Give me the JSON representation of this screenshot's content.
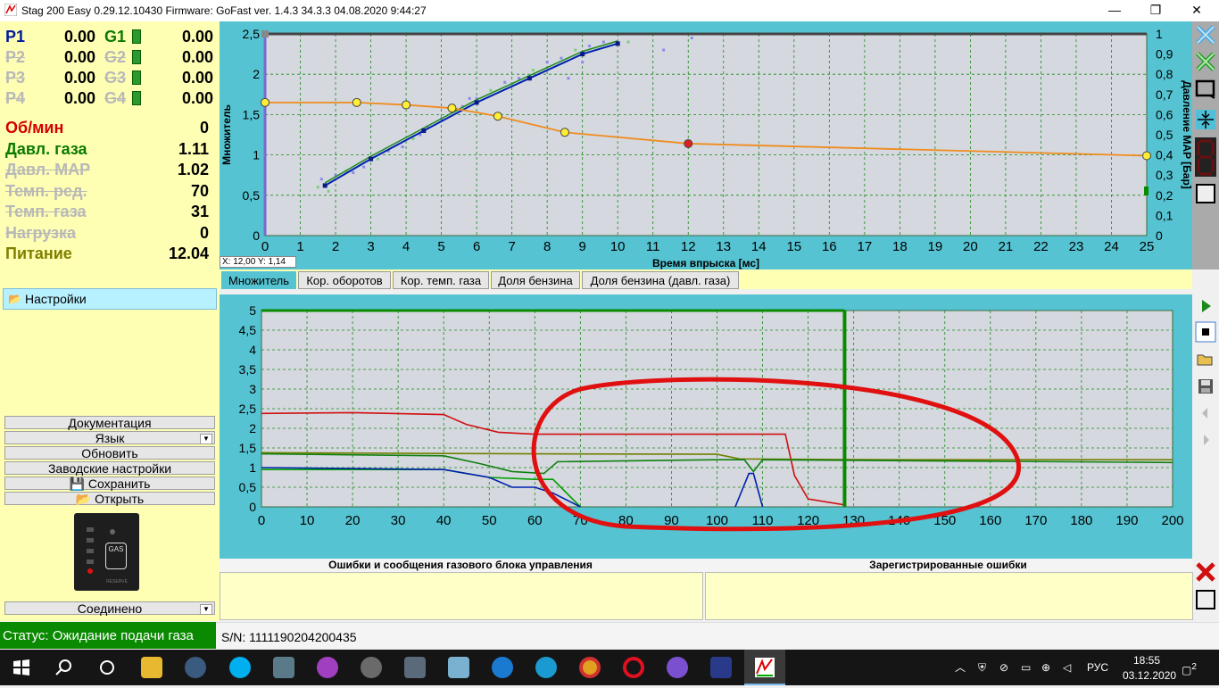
{
  "window": {
    "title": "Stag 200 Easy 0.29.12.10430 Firmware: GoFast  ver. 1.4.3  34.3.3   04.08.2020 9:44:27",
    "minimize": "—",
    "maximize": "❐",
    "close": "✕"
  },
  "injectors": [
    {
      "p": "P1",
      "p_val": "0.00",
      "g": "G1",
      "g_val": "0.00",
      "active": true
    },
    {
      "p": "P2",
      "p_val": "0.00",
      "g": "G2",
      "g_val": "0.00",
      "active": false
    },
    {
      "p": "P3",
      "p_val": "0.00",
      "g": "G3",
      "g_val": "0.00",
      "active": false
    },
    {
      "p": "P4",
      "p_val": "0.00",
      "g": "G4",
      "g_val": "0.00",
      "active": false
    }
  ],
  "params": [
    {
      "label": "Об/мин",
      "value": "0",
      "style": "red"
    },
    {
      "label": "Давл. газа",
      "value": "1.11",
      "style": "green"
    },
    {
      "label": "Давл. MAP",
      "value": "1.02",
      "style": "strike"
    },
    {
      "label": "Темп. ред.",
      "value": "70",
      "style": "strike"
    },
    {
      "label": "Темп. газа",
      "value": "31",
      "style": "strike"
    },
    {
      "label": "Нагрузка",
      "value": "0",
      "style": "strike"
    },
    {
      "label": "Питание",
      "value": "12.04",
      "style": "olive"
    }
  ],
  "settings": {
    "label": "Настройки"
  },
  "buttons": {
    "documentation": "Документация",
    "language": "Язык",
    "update": "Обновить",
    "factory": "Заводские настройки",
    "save": "Сохранить",
    "open": "Открыть",
    "connection": "Соединено"
  },
  "ecu": {
    "label": "GAS",
    "sublabel": "RESERVE"
  },
  "status": "Статус: Ожидание подачи газа",
  "serial": "S/N: 1111190204200435",
  "top_chart": {
    "ylabel": "Множитель",
    "xlabel": "Время впрыска [мс]",
    "y2label": "Давление MAP [Бар]",
    "cursor": "X: 12,00  Y: 1,14"
  },
  "tabs": [
    "Множитель",
    "Кор. оборотов",
    "Кор. темп. газа",
    "Доля бензина",
    "Доля бензина (давл. газа)"
  ],
  "errors": {
    "left_header": "Ошибки и сообщения газового блока управления",
    "right_header": "Зарегистрированные ошибки"
  },
  "taskbar": {
    "lang": "РУС",
    "time": "18:55",
    "date": "03.12.2020",
    "notif": "2"
  },
  "colors": {
    "chart_bg": "#d5d8df",
    "panel": "#55c3d2",
    "left_bg": "#ffffb4",
    "status_green": "#0a8a00",
    "multiplier": "#f08c1e",
    "fit_line": "#0020b0"
  },
  "chart_data": [
    {
      "type": "line",
      "xlim": [
        0,
        25
      ],
      "ylim": [
        0,
        2.5
      ],
      "y2lim": [
        0,
        1
      ],
      "x_ticks": [
        0,
        1,
        2,
        3,
        4,
        5,
        6,
        7,
        8,
        9,
        10,
        11,
        12,
        13,
        14,
        15,
        16,
        17,
        18,
        19,
        20,
        21,
        22,
        23,
        24,
        25
      ],
      "y_ticks": [
        "0",
        "0,5",
        "1",
        "1,5",
        "2",
        "2,5"
      ],
      "y2_ticks": [
        "0",
        "0,1",
        "0,2",
        "0,3",
        "0,4",
        "0,5",
        "0,6",
        "0,7",
        "0,8",
        "0,9",
        "1"
      ],
      "series": [
        {
          "role": "multiplier",
          "color": "#f08c1e",
          "x": [
            0,
            2.6,
            4,
            5.3,
            6.6,
            8.5,
            12,
            25
          ],
          "y": [
            1.65,
            1.65,
            1.62,
            1.58,
            1.48,
            1.28,
            1.14,
            0.99
          ]
        },
        {
          "role": "fit",
          "color": "#0020b0",
          "x": [
            1.7,
            3,
            4.5,
            6,
            7.5,
            9,
            10
          ],
          "y": [
            0.62,
            0.95,
            1.3,
            1.65,
            1.95,
            2.25,
            2.38
          ]
        }
      ],
      "points": [
        {
          "x": 0,
          "y": 1.65,
          "c": "#ffee33"
        },
        {
          "x": 2.6,
          "y": 1.65,
          "c": "#ffee33"
        },
        {
          "x": 4,
          "y": 1.62,
          "c": "#ffee33"
        },
        {
          "x": 5.3,
          "y": 1.58,
          "c": "#ffee33"
        },
        {
          "x": 6.6,
          "y": 1.48,
          "c": "#ffee33"
        },
        {
          "x": 8.5,
          "y": 1.28,
          "c": "#ffee33"
        },
        {
          "x": 12,
          "y": 1.14,
          "c": "#e02020"
        },
        {
          "x": 25,
          "y": 0.99,
          "c": "#ffee33"
        }
      ]
    },
    {
      "type": "line",
      "xlim": [
        0,
        200
      ],
      "ylim": [
        0,
        5
      ],
      "x_ticks": [
        0,
        10,
        20,
        30,
        40,
        50,
        60,
        70,
        80,
        90,
        100,
        110,
        120,
        130,
        140,
        150,
        160,
        170,
        180,
        190,
        200
      ],
      "y_ticks": [
        "0",
        "0,5",
        "1",
        "1,5",
        "2",
        "2,5",
        "3",
        "3,5",
        "4",
        "4,5",
        "5"
      ],
      "series": [
        {
          "color": "#d01010",
          "x": [
            0,
            20,
            40,
            45,
            52,
            60,
            70,
            115,
            117,
            120,
            128
          ],
          "y": [
            2.38,
            2.4,
            2.35,
            2.1,
            1.9,
            1.85,
            1.85,
            1.85,
            0.8,
            0.2,
            0.05
          ]
        },
        {
          "color": "#708000",
          "x": [
            0,
            40,
            60,
            100,
            105,
            140,
            200
          ],
          "y": [
            1.38,
            1.36,
            1.35,
            1.34,
            1.22,
            1.2,
            1.2
          ]
        },
        {
          "color": "#108010",
          "x": [
            0,
            40,
            48,
            55,
            62,
            65,
            100,
            106,
            108,
            110,
            200
          ],
          "y": [
            1.35,
            1.3,
            1.1,
            0.9,
            0.85,
            1.15,
            1.2,
            1.2,
            0.9,
            1.2,
            1.13
          ]
        },
        {
          "color": "#00a000",
          "x": [
            0,
            40,
            50,
            60,
            64,
            70
          ],
          "y": [
            0.95,
            0.95,
            0.75,
            0.7,
            0.7,
            0
          ]
        },
        {
          "color": "#0020b0",
          "x": [
            0,
            40,
            50,
            55,
            60,
            64,
            70
          ],
          "y": [
            1.0,
            0.95,
            0.75,
            0.5,
            0.5,
            0.35,
            0
          ]
        },
        {
          "color": "#0020b0",
          "x": [
            104,
            107,
            108,
            110
          ],
          "y": [
            0,
            0.85,
            0.85,
            0
          ]
        },
        {
          "color": "#0a8a00",
          "x": [
            128,
            128
          ],
          "y": [
            5,
            0
          ],
          "width": 4
        }
      ],
      "marker_line": {
        "x": 128,
        "color": "#0a8a00"
      }
    }
  ]
}
